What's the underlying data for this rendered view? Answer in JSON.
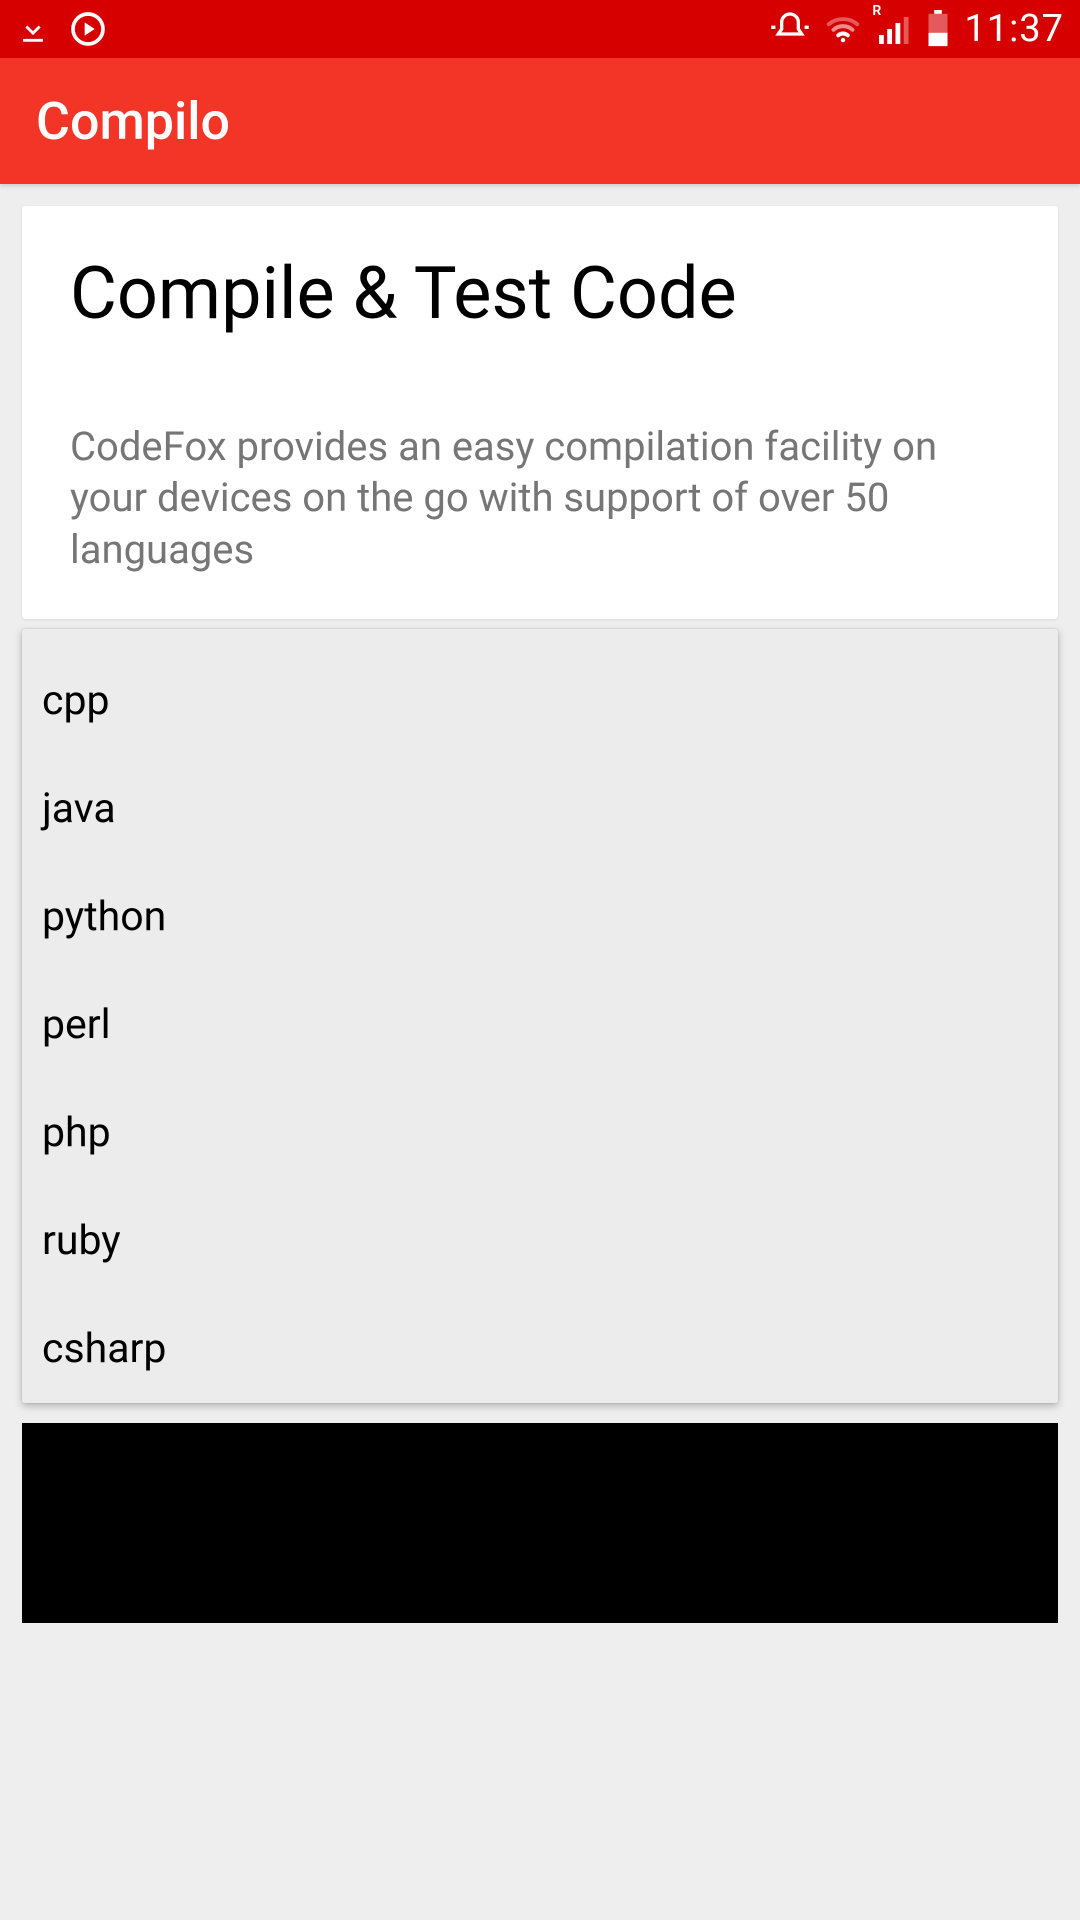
{
  "status": {
    "time": "11:37",
    "signal_label": "R"
  },
  "appbar": {
    "title": "Compilo"
  },
  "card": {
    "title": "Compile & Test Code",
    "body": "CodeFox provides an easy compilation facility on your devices on the go with support of over 50 languages"
  },
  "dropdown": {
    "items": [
      "cpp",
      "java",
      "python",
      "perl",
      "php",
      "ruby",
      "csharp"
    ]
  }
}
